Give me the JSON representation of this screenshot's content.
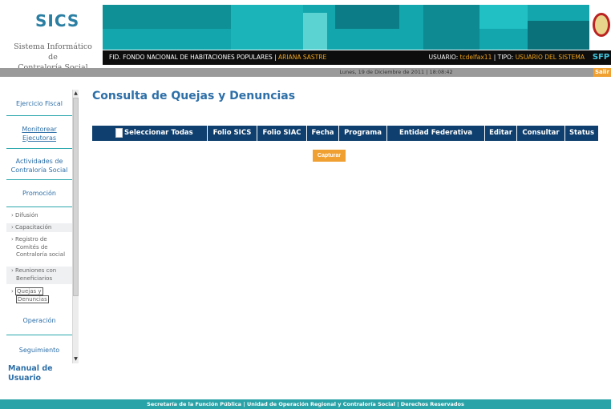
{
  "app": {
    "title": "SICS",
    "subtitle_line1": "Sistema Informático de",
    "subtitle_line2": "Contraloría Social"
  },
  "header": {
    "program_label": "FID. FONDO NACIONAL DE HABITACIONES POPULARES",
    "user_name": "ARIANA SASTRE",
    "usuario_label": "USUARIO:",
    "usuario_value": "tcdelfax11",
    "tipo_label": "TIPO:",
    "tipo_value": "USUARIO DEL SISTEMA",
    "agency": "SFP",
    "date": "Lunes, 19 de Diciembre de 2011",
    "time": "18:08:42",
    "logout_label": "Salir"
  },
  "sidebar": {
    "items": [
      {
        "label": "Ejercicio Fiscal"
      },
      {
        "label_line1": "Monitorear",
        "label_line2": "Ejecutoras"
      },
      {
        "label_line1": "Actividades de",
        "label_line2": "Contraloría Social"
      },
      {
        "label": "Promoción"
      }
    ],
    "subitems": [
      {
        "label": "Difusión"
      },
      {
        "label": "Capacitación"
      },
      {
        "label_line1": "Registro de",
        "label_line2": "Comités de",
        "label_line3": "Contraloría social"
      },
      {
        "label_line1": "Reuniones con",
        "label_line2": "Beneficiarios"
      },
      {
        "label_line1": "Quejas y",
        "label_line2": "Denuncias"
      }
    ],
    "bottom_items": [
      {
        "label": "Operación"
      },
      {
        "label": "Seguimiento"
      }
    ],
    "manual_line1": "Manual de",
    "manual_line2": "Usuario"
  },
  "main": {
    "title": "Consulta de Quejas y Denuncias",
    "columns": [
      "Seleccionar Todas",
      "Folio SICS",
      "Folio SIAC",
      "Fecha",
      "Programa",
      "Entidad Federativa",
      "Editar",
      "Consultar",
      "Status"
    ],
    "capture_button": "Capturar"
  },
  "footer": {
    "text": "Secretaría de la Función Pública | Unidad de Operación Regional y Contraloría Social | Derechos Reservados"
  },
  "colors": {
    "accent": "#2d6fa8",
    "header_table": "#0f3f6e",
    "teal": "#2aa3a8",
    "orange": "#f0a030"
  }
}
